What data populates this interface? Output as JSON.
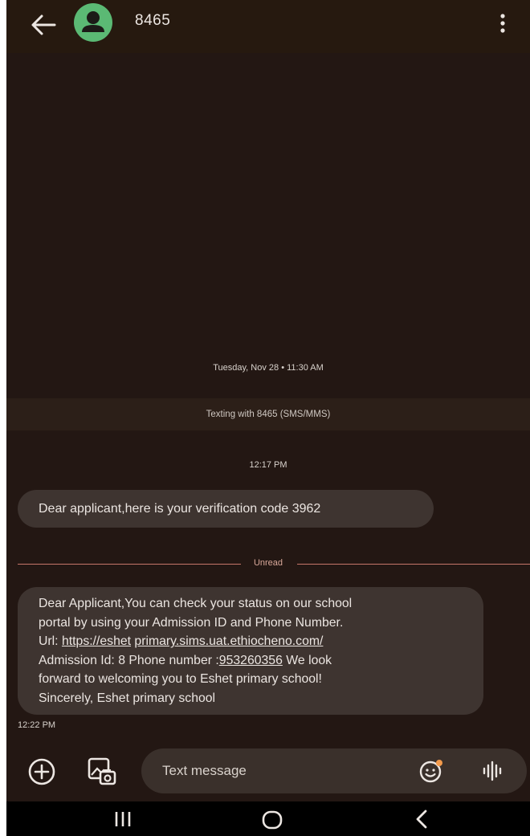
{
  "header": {
    "contact_name": "8465"
  },
  "conversation": {
    "date_stamp": "Tuesday, Nov 28 • 11:30 AM",
    "texting_banner": "Texting with 8465 (SMS/MMS)",
    "messages": [
      {
        "time": "12:17 PM",
        "text": "Dear  applicant,here is your verification code 3962"
      },
      {
        "time": "12:22 PM",
        "line1": "Dear Applicant,You can check your status on our school",
        "line2": "portal by using your Admission ID and Phone Number.",
        "line3_prefix": "Url: ",
        "link_part1": "https://eshet",
        "link_part2": "primary.sims.uat.ethiocheno.com/",
        "line4_prefix": "Admission Id: 8 Phone number :",
        "phone_link": "953260356",
        "line4_suffix": " We look",
        "line5": "forward to welcoming you to Eshet primary school!",
        "line6": "Sincerely, Eshet primary school"
      }
    ],
    "unread_label": "Unread"
  },
  "composer": {
    "placeholder": "Text message"
  },
  "icons": {
    "back": "back-arrow-icon",
    "avatar": "person-icon",
    "more": "more-vert-icon",
    "add": "add-circle-icon",
    "gallery": "gallery-icon",
    "emoji": "emoji-icon",
    "voice": "voice-wave-icon",
    "recents": "recents-icon",
    "home": "home-icon",
    "nav_back": "nav-back-icon"
  },
  "colors": {
    "background": "#231713",
    "bubble": "#3e3430",
    "avatar": "#5bb974",
    "unread_line": "#c7766a"
  }
}
